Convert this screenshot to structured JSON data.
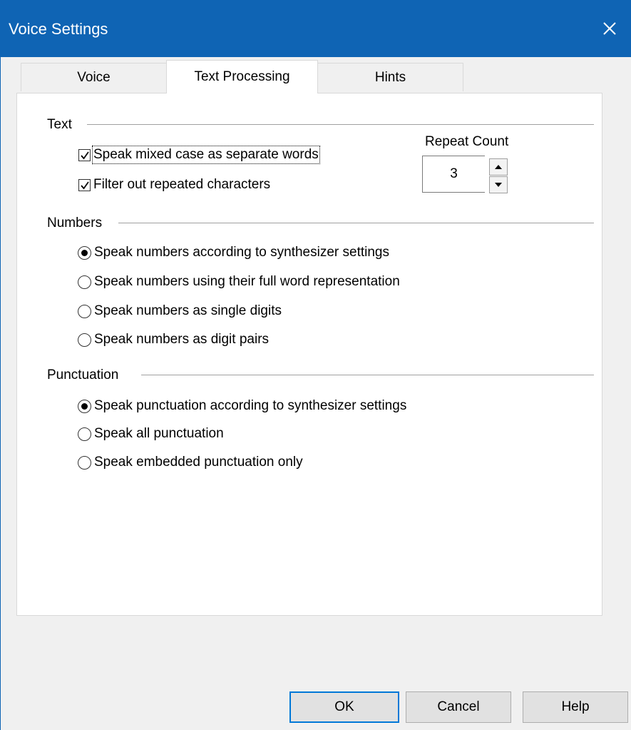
{
  "window": {
    "title": "Voice Settings"
  },
  "tabs": [
    {
      "label": "Voice"
    },
    {
      "label": "Text Processing"
    },
    {
      "label": "Hints"
    }
  ],
  "text_group": {
    "label": "Text",
    "options": [
      {
        "label": "Speak mixed case as separate words",
        "checked": true
      },
      {
        "label": "Filter out repeated characters",
        "checked": true
      }
    ],
    "repeat_count": {
      "label": "Repeat Count",
      "value": "3"
    }
  },
  "numbers_group": {
    "label": "Numbers",
    "options": [
      {
        "label": "Speak numbers according to synthesizer settings",
        "selected": true
      },
      {
        "label": "Speak numbers using their full word representation",
        "selected": false
      },
      {
        "label": "Speak numbers as single digits",
        "selected": false
      },
      {
        "label": "Speak numbers as digit pairs",
        "selected": false
      }
    ]
  },
  "punctuation_group": {
    "label": "Punctuation",
    "options": [
      {
        "label": "Speak punctuation according to synthesizer settings",
        "selected": true
      },
      {
        "label": "Speak all punctuation",
        "selected": false
      },
      {
        "label": "Speak embedded punctuation only",
        "selected": false
      }
    ]
  },
  "buttons": {
    "ok": "OK",
    "cancel": "Cancel",
    "help": "Help"
  },
  "colors": {
    "titlebar": "#0f64b4",
    "default_button_border": "#0078d7"
  }
}
